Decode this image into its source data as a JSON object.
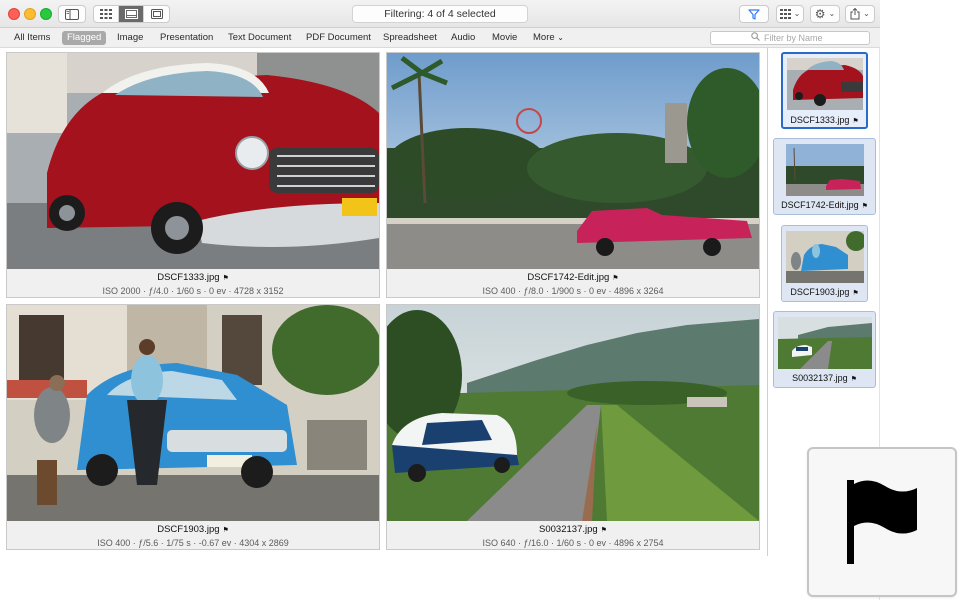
{
  "toolbar": {
    "filter_status": "Filtering: 4 of 4 selected"
  },
  "filters": {
    "tabs": [
      "All Items",
      "Flagged",
      "Image",
      "Presentation",
      "Text Document",
      "PDF Document",
      "Spreadsheet",
      "Audio",
      "Movie",
      "More"
    ],
    "selected": "Flagged",
    "search_placeholder": "Filter by Name"
  },
  "grid": [
    {
      "name": "DSCF1333.jpg",
      "flag": "⚑",
      "meta": "ISO 2000  ·  ƒ/4.0  ·  1/60 s  ·  0 ev  ·  4728 x 3152"
    },
    {
      "name": "DSCF1742-Edit.jpg",
      "flag": "⚑",
      "meta": "ISO 400  ·  ƒ/8.0  ·  1/900 s  ·  0 ev  ·  4896 x 3264"
    },
    {
      "name": "DSCF1903.jpg",
      "flag": "⚑",
      "meta": "ISO 400  ·  ƒ/5.6  ·  1/75 s  ·  -0.67 ev  ·  4304 x 2869"
    },
    {
      "name": "S0032137.jpg",
      "flag": "⚑",
      "meta": "ISO 640  ·  ƒ/16.0  ·  1/60 s  ·  0 ev  ·  4896 x 2754"
    }
  ],
  "sidebar": [
    {
      "name": "DSCF1333.jpg",
      "flag": "⚑"
    },
    {
      "name": "DSCF1742-Edit.jpg",
      "flag": "⚑"
    },
    {
      "name": "DSCF1903.jpg",
      "flag": "⚑"
    },
    {
      "name": "S0032137.jpg",
      "flag": "⚑"
    }
  ],
  "icons": {
    "flag_badge": "flag-icon",
    "filter": "filter-icon",
    "search": "search-icon"
  },
  "colors": {
    "selection": "#2a68c9",
    "filter_active": "#2f7cf6"
  }
}
